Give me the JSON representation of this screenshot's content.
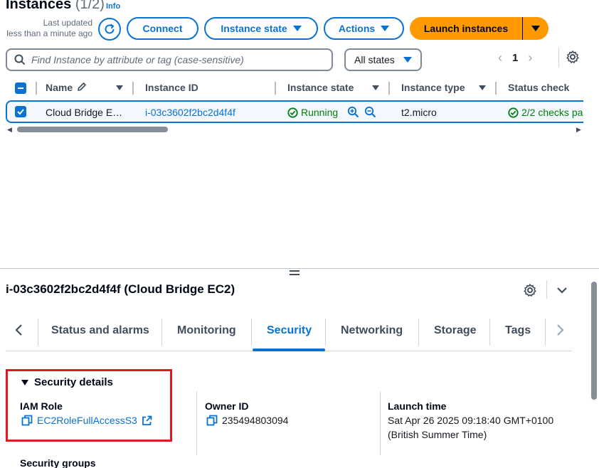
{
  "header": {
    "title": "Instances",
    "count": "(1/2)",
    "info": "Info",
    "last_updated_line1": "Last updated",
    "last_updated_line2": "less than a minute ago"
  },
  "toolbar": {
    "connect": "Connect",
    "instance_state": "Instance state",
    "actions": "Actions",
    "launch": "Launch instances"
  },
  "filter": {
    "search_placeholder": "Find Instance by attribute or tag (case-sensitive)",
    "states_value": "All states",
    "page": "1"
  },
  "table": {
    "columns": [
      "Name",
      "Instance ID",
      "Instance state",
      "Instance type",
      "Status check"
    ],
    "row": {
      "name": "Cloud Bridge E…",
      "instance_id": "i-03c3602f2bc2d4f4f",
      "state": "Running",
      "type": "t2.micro",
      "status_check": "2/2 checks pa"
    }
  },
  "panel": {
    "title": "i-03c3602f2bc2d4f4f (Cloud Bridge EC2)",
    "tabs": [
      "Status and alarms",
      "Monitoring",
      "Security",
      "Networking",
      "Storage",
      "Tags"
    ],
    "active_tab": "Security",
    "section_title": "Security details",
    "iam_role_label": "IAM Role",
    "iam_role_value": "EC2RoleFullAccessS3",
    "owner_id_label": "Owner ID",
    "owner_id_value": "235494803094",
    "launch_time_label": "Launch time",
    "launch_time_line1": "Sat Apr 26 2025 09:18:40 GMT+0100",
    "launch_time_line2": "(British Summer Time)",
    "security_groups_label": "Security groups"
  },
  "colors": {
    "accent": "#0972d3",
    "launch": "#ff9900",
    "success": "#037f0c",
    "highlight": "#e0181f"
  }
}
